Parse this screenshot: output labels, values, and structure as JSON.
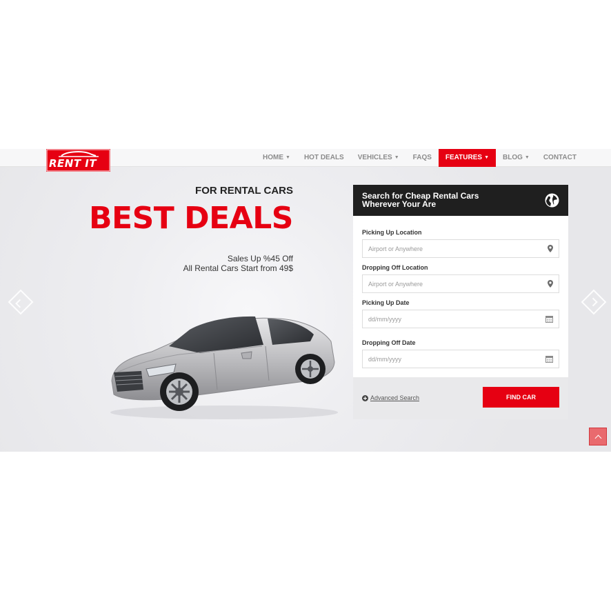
{
  "brand": {
    "logo_text": "RENT IT",
    "accent_color": "#e60012"
  },
  "nav": {
    "items": [
      {
        "label": "Home",
        "dropdown": true,
        "active": false
      },
      {
        "label": "Hot Deals",
        "dropdown": false,
        "active": false
      },
      {
        "label": "Vehicles",
        "dropdown": true,
        "active": false
      },
      {
        "label": "FAQS",
        "dropdown": false,
        "active": false
      },
      {
        "label": "Features",
        "dropdown": true,
        "active": true
      },
      {
        "label": "Blog",
        "dropdown": true,
        "active": false
      },
      {
        "label": "Contact",
        "dropdown": false,
        "active": false
      }
    ]
  },
  "hero": {
    "subtitle": "FOR RENTAL CARS",
    "title": "BEST DEALS",
    "line1": "Sales Up %45 Off",
    "line2": "All Rental Cars Start from 49$"
  },
  "search": {
    "title_line1": "Search for Cheap Rental Cars",
    "title_line2": "Wherever Your Are",
    "pickup_location_label": "Picking Up Location",
    "pickup_location_placeholder": "Airport or Anywhere",
    "dropoff_location_label": "Dropping Off Location",
    "dropoff_location_placeholder": "Airport or Anywhere",
    "pickup_date_label": "Picking Up Date",
    "pickup_date_placeholder": "dd/mm/yyyy",
    "dropoff_date_label": "Dropping Off Date",
    "dropoff_date_placeholder": "dd/mm/yyyy",
    "advanced_label": "Advanced Search",
    "find_button": "Find Car"
  },
  "icons": {
    "globe": "globe-icon",
    "location": "map-marker-icon",
    "calendar": "calendar-icon",
    "plus": "plus-circle-icon",
    "back_to_top": "chevron-up-icon"
  }
}
